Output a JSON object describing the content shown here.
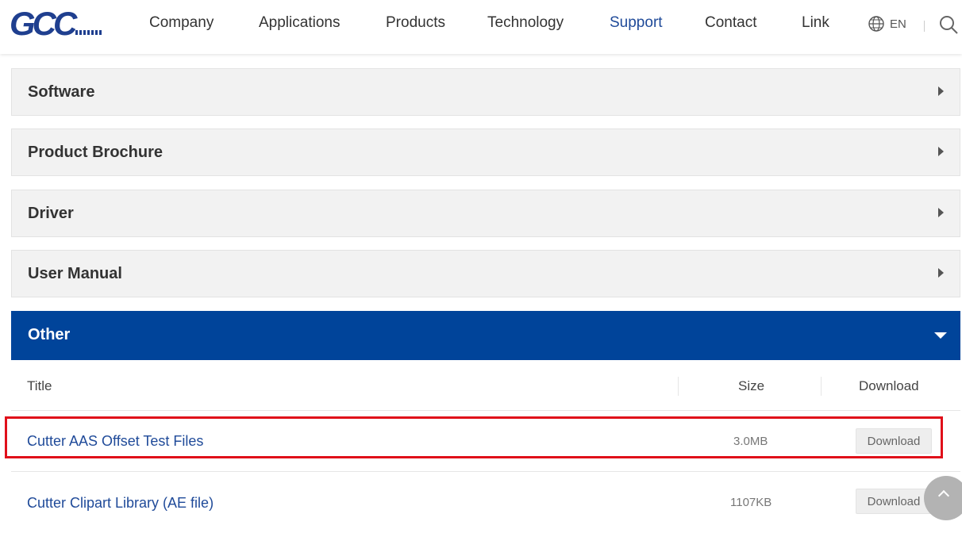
{
  "header": {
    "logo": "GCC",
    "nav": [
      {
        "label": "Company"
      },
      {
        "label": "Applications"
      },
      {
        "label": "Products"
      },
      {
        "label": "Technology"
      },
      {
        "label": "Support",
        "active": true
      },
      {
        "label": "Contact"
      },
      {
        "label": "Link"
      }
    ],
    "lang_label": "EN",
    "lang_icon": "globe-icon",
    "search_icon": "search-icon"
  },
  "accordion": [
    {
      "title": "Software",
      "state": "collapsed"
    },
    {
      "title": "Product Brochure",
      "state": "collapsed"
    },
    {
      "title": "Driver",
      "state": "collapsed"
    },
    {
      "title": "User Manual",
      "state": "collapsed"
    },
    {
      "title": "Other",
      "state": "expanded"
    }
  ],
  "table": {
    "headers": {
      "title": "Title",
      "size": "Size",
      "download": "Download"
    },
    "rows": [
      {
        "title": "Cutter AAS Offset Test Files",
        "size": "3.0MB",
        "button": "Download",
        "highlighted": true
      },
      {
        "title": "Cutter Clipart Library (AE file)",
        "size": "1107KB",
        "button": "Download",
        "highlighted": false
      }
    ]
  },
  "colors": {
    "brand": "#1f3f8f",
    "active_nav": "#1f4a99",
    "accordion_open": "#00449a",
    "highlight": "#e0101a"
  },
  "back_to_top_icon": "chevron-up-icon"
}
